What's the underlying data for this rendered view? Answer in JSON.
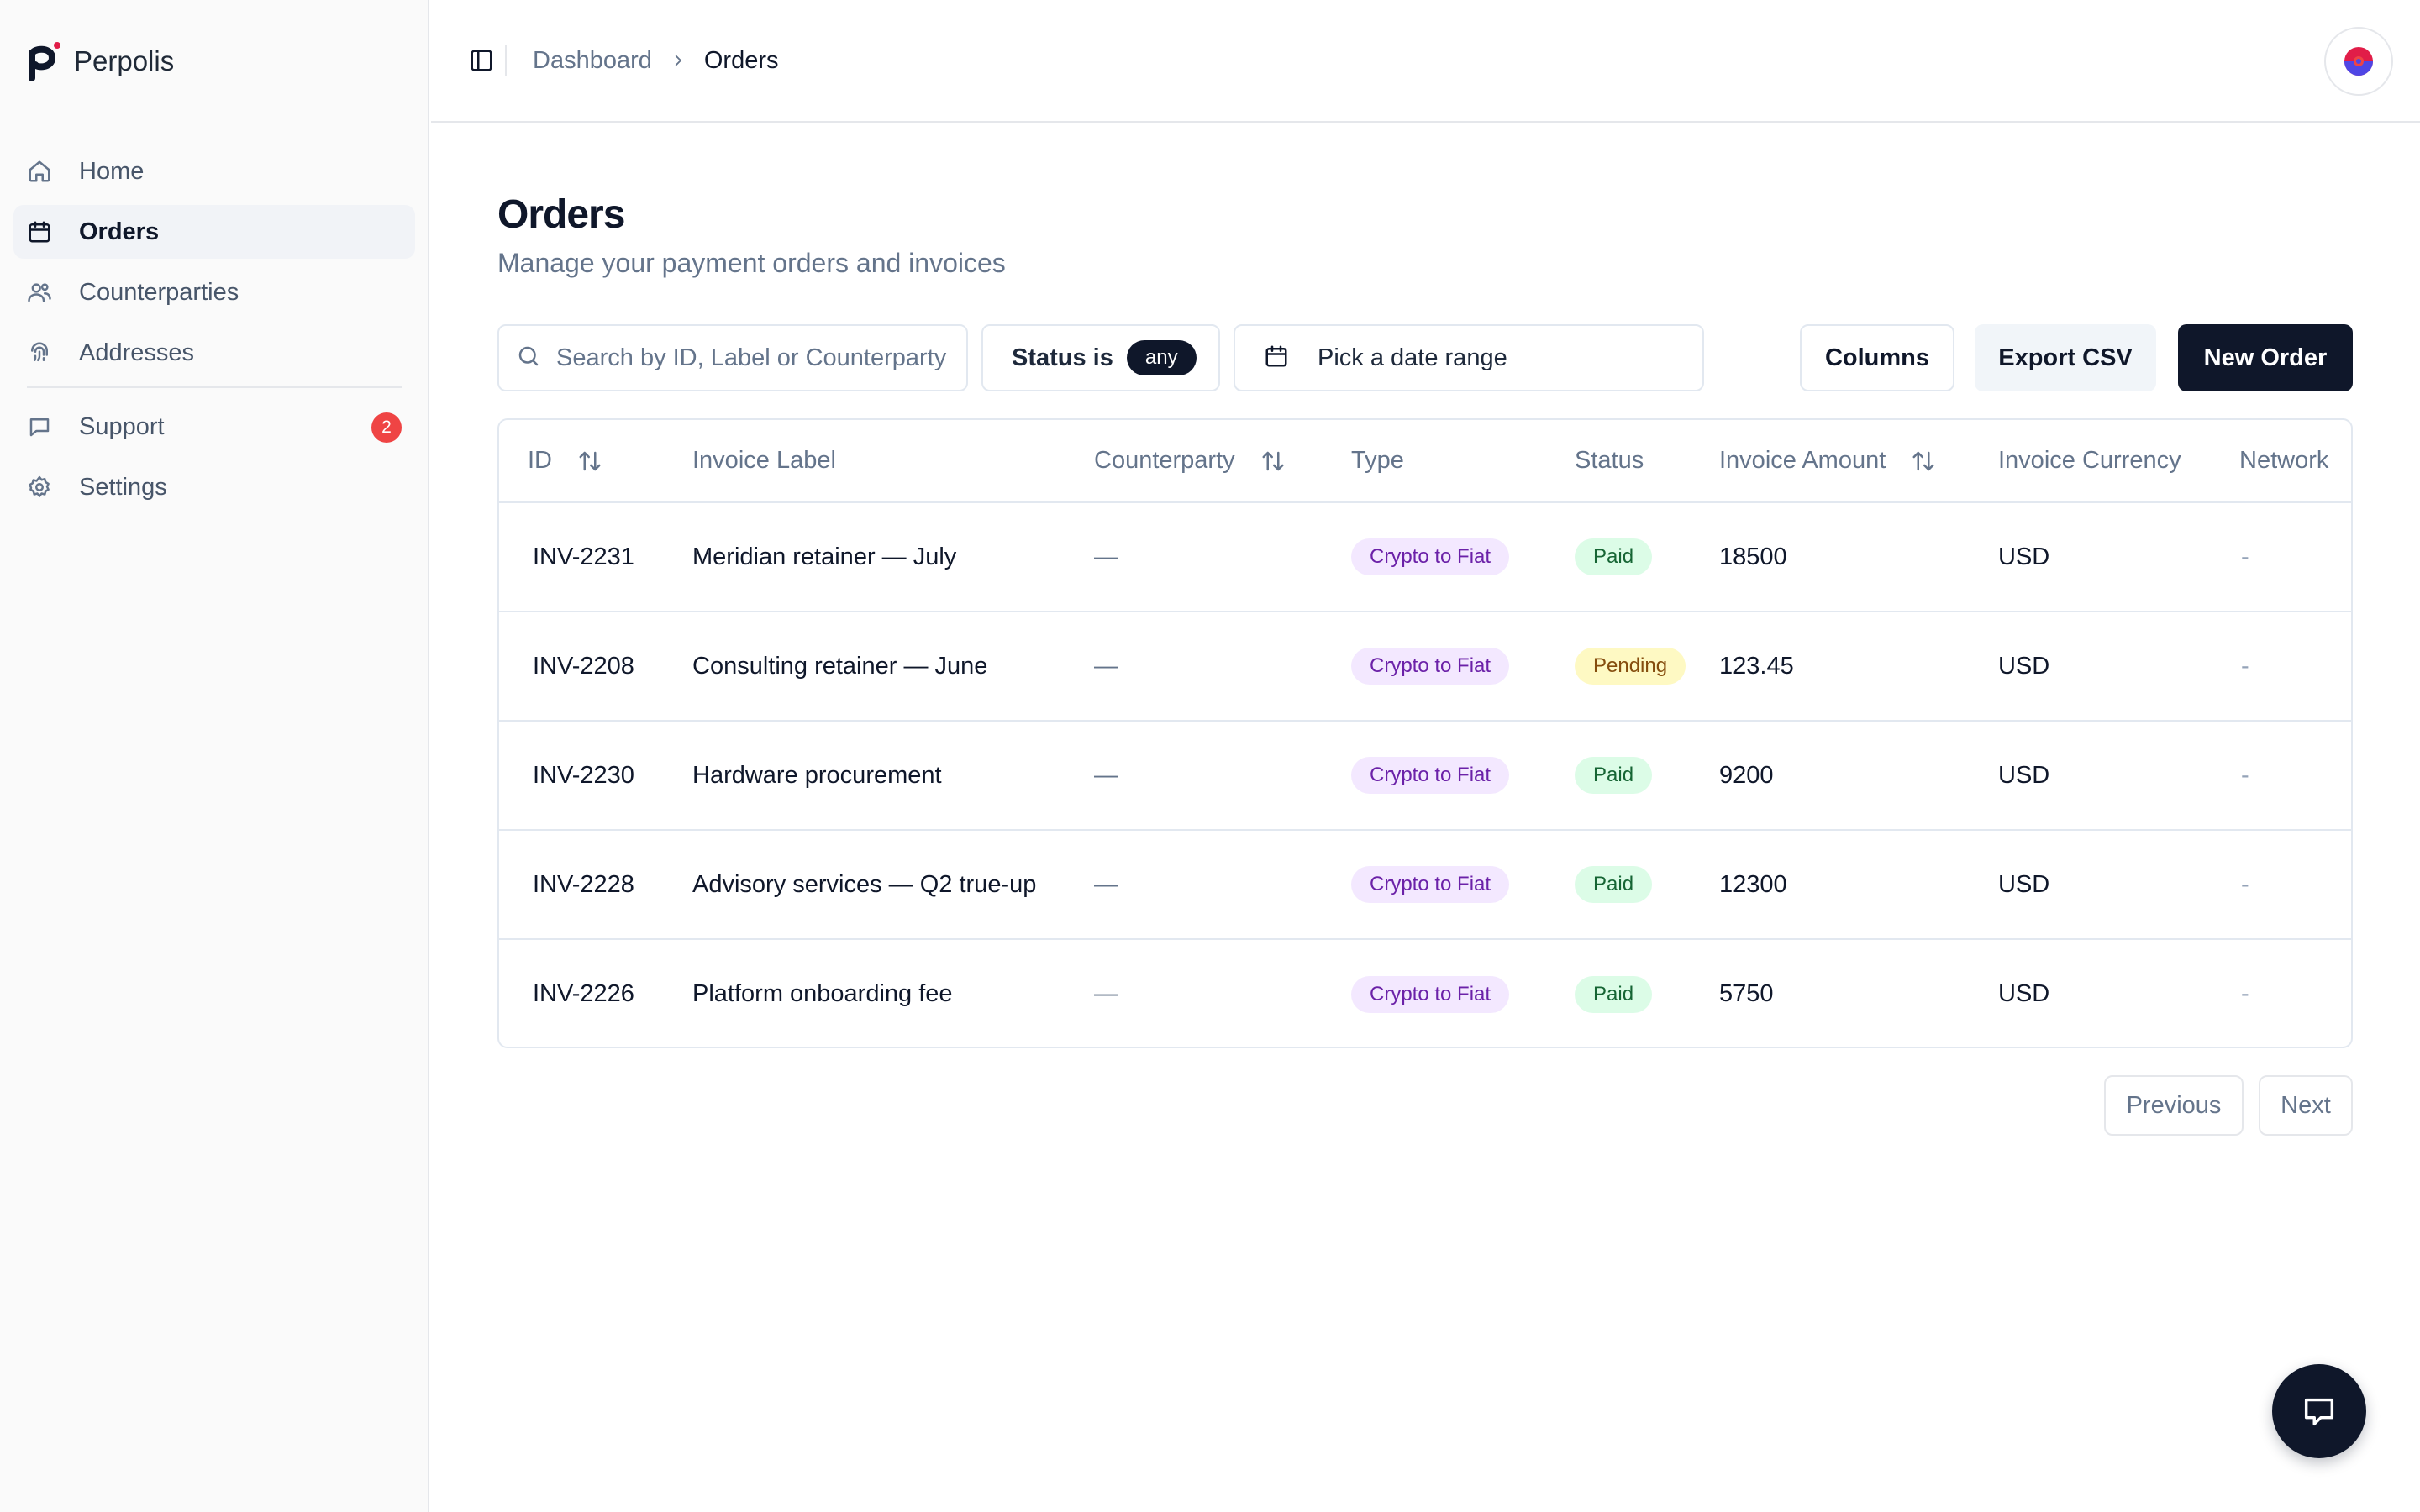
{
  "brand": {
    "name": "Perpolis"
  },
  "sidebar": {
    "items": [
      {
        "label": "Home",
        "icon": "home-icon",
        "active": false
      },
      {
        "label": "Orders",
        "icon": "calendar-icon",
        "active": true
      },
      {
        "label": "Counterparties",
        "icon": "users-icon",
        "active": false
      },
      {
        "label": "Addresses",
        "icon": "fingerprint-icon",
        "active": false
      },
      {
        "label": "Support",
        "icon": "message-icon",
        "active": false,
        "badge": "2"
      },
      {
        "label": "Settings",
        "icon": "gear-icon",
        "active": false
      }
    ]
  },
  "header": {
    "breadcrumb": {
      "parent": "Dashboard",
      "current": "Orders"
    }
  },
  "main": {
    "title": "Orders",
    "subtitle": "Manage your payment orders and invoices",
    "search": {
      "placeholder": "Search by ID, Label or Counterparty",
      "value": ""
    },
    "status_filter": {
      "label": "Status is",
      "value": "any"
    },
    "date_range": {
      "placeholder": "Pick a date range"
    },
    "buttons": {
      "columns": "Columns",
      "export": "Export CSV",
      "new_order": "New Order"
    }
  },
  "table": {
    "columns": [
      "ID",
      "Invoice Label",
      "Counterparty",
      "Type",
      "Status",
      "Invoice Amount",
      "Invoice Currency",
      "Network"
    ],
    "rows": [
      {
        "id": "INV-2231",
        "label": "Meridian retainer — July",
        "counterparty": "—",
        "type": "Crypto to Fiat",
        "status": "Paid",
        "amount": "18500",
        "currency": "USD",
        "network": "-"
      },
      {
        "id": "INV-2208",
        "label": "Consulting retainer — June",
        "counterparty": "—",
        "type": "Crypto to Fiat",
        "status": "Pending",
        "amount": "123.45",
        "currency": "USD",
        "network": "-"
      },
      {
        "id": "INV-2230",
        "label": "Hardware procurement",
        "counterparty": "—",
        "type": "Crypto to Fiat",
        "status": "Paid",
        "amount": "9200",
        "currency": "USD",
        "network": "-"
      },
      {
        "id": "INV-2228",
        "label": "Advisory services — Q2 true-up",
        "counterparty": "—",
        "type": "Crypto to Fiat",
        "status": "Paid",
        "amount": "12300",
        "currency": "USD",
        "network": "-"
      },
      {
        "id": "INV-2226",
        "label": "Platform onboarding fee",
        "counterparty": "—",
        "type": "Crypto to Fiat",
        "status": "Paid",
        "amount": "5750",
        "currency": "USD",
        "network": "-"
      }
    ]
  },
  "pagination": {
    "previous": "Previous",
    "next": "Next"
  },
  "colors": {
    "primary": "#0f172a",
    "badge_red": "#ef4444",
    "logo_accent": "#e11d48",
    "type_pill_bg": "#f3e8ff",
    "paid_pill_bg": "#dcfce7",
    "pending_pill_bg": "#fef9c3"
  }
}
